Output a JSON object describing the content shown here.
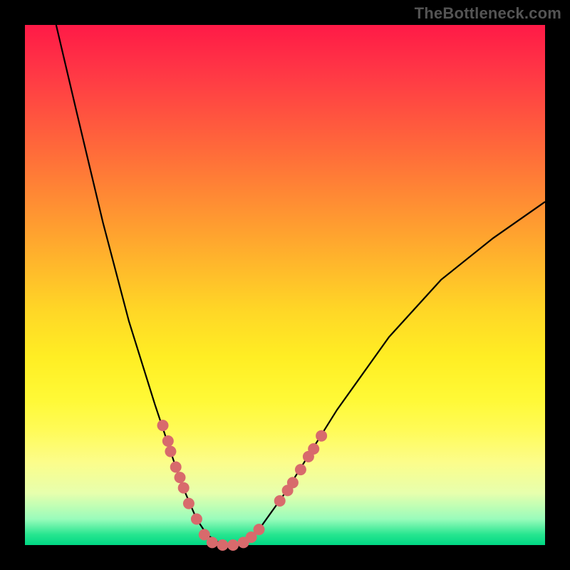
{
  "watermark": "TheBottleneck.com",
  "chart_data": {
    "type": "line",
    "title": "",
    "xlabel": "",
    "ylabel": "",
    "xlim": [
      0,
      100
    ],
    "ylim": [
      0,
      100
    ],
    "grid": false,
    "legend": false,
    "series": [
      {
        "name": "bottleneck-curve",
        "description": "V-shaped curve descending steeply from top-left, reaching a flat minimum near y=0 around x≈35–42, then rising with decreasing slope toward the upper-right.",
        "x": [
          6,
          10,
          15,
          20,
          25,
          30,
          33,
          35,
          38,
          40,
          42,
          45,
          50,
          55,
          60,
          70,
          80,
          90,
          100
        ],
        "y": [
          100,
          83,
          62,
          43,
          27,
          12,
          5,
          2,
          0,
          0,
          0.5,
          3,
          10,
          18,
          26,
          40,
          51,
          59,
          66
        ]
      }
    ],
    "markers": {
      "name": "cluster-points",
      "color": "#d86a6c",
      "radius_px": 8,
      "points": [
        {
          "x": 26.5,
          "y": 23
        },
        {
          "x": 27.5,
          "y": 20
        },
        {
          "x": 28.0,
          "y": 18
        },
        {
          "x": 29.0,
          "y": 15
        },
        {
          "x": 29.8,
          "y": 13
        },
        {
          "x": 30.5,
          "y": 11
        },
        {
          "x": 31.5,
          "y": 8
        },
        {
          "x": 33.0,
          "y": 5
        },
        {
          "x": 34.5,
          "y": 2
        },
        {
          "x": 36.0,
          "y": 0.5
        },
        {
          "x": 38.0,
          "y": 0
        },
        {
          "x": 40.0,
          "y": 0
        },
        {
          "x": 42.0,
          "y": 0.5
        },
        {
          "x": 43.5,
          "y": 1.5
        },
        {
          "x": 45.0,
          "y": 3
        },
        {
          "x": 49.0,
          "y": 8.5
        },
        {
          "x": 50.5,
          "y": 10.5
        },
        {
          "x": 51.5,
          "y": 12
        },
        {
          "x": 53.0,
          "y": 14.5
        },
        {
          "x": 54.5,
          "y": 17
        },
        {
          "x": 55.5,
          "y": 18.5
        },
        {
          "x": 57.0,
          "y": 21
        }
      ]
    },
    "background_gradient": {
      "direction": "top-to-bottom",
      "stops": [
        {
          "pos": 0.0,
          "color": "#ff1a47"
        },
        {
          "pos": 0.55,
          "color": "#ffd726"
        },
        {
          "pos": 0.95,
          "color": "#99fcbb"
        },
        {
          "pos": 1.0,
          "color": "#00d884"
        }
      ]
    }
  }
}
